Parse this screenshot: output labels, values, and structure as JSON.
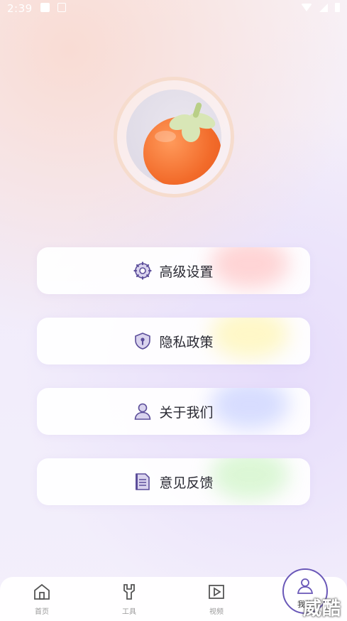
{
  "status_bar": {
    "time": "2:39"
  },
  "menu": [
    {
      "label": "高级设置",
      "icon": "gear-icon",
      "glow": "#ffb3b3"
    },
    {
      "label": "隐私政策",
      "icon": "shield-icon",
      "glow": "#fff39a"
    },
    {
      "label": "关于我们",
      "icon": "user-icon",
      "glow": "#b7c2ff"
    },
    {
      "label": "意见反馈",
      "icon": "document-icon",
      "glow": "#bff2b3"
    }
  ],
  "bottom_nav": {
    "items": [
      {
        "label": "首页",
        "icon": "home-icon"
      },
      {
        "label": "工具",
        "icon": "wrench-icon"
      },
      {
        "label": "视频",
        "icon": "video-icon"
      },
      {
        "label": "我的",
        "icon": "profile-icon",
        "active": true
      }
    ]
  },
  "watermark": "威酷",
  "colors": {
    "accent": "#6a58b8",
    "avatar_ring": "#f6dccd"
  }
}
